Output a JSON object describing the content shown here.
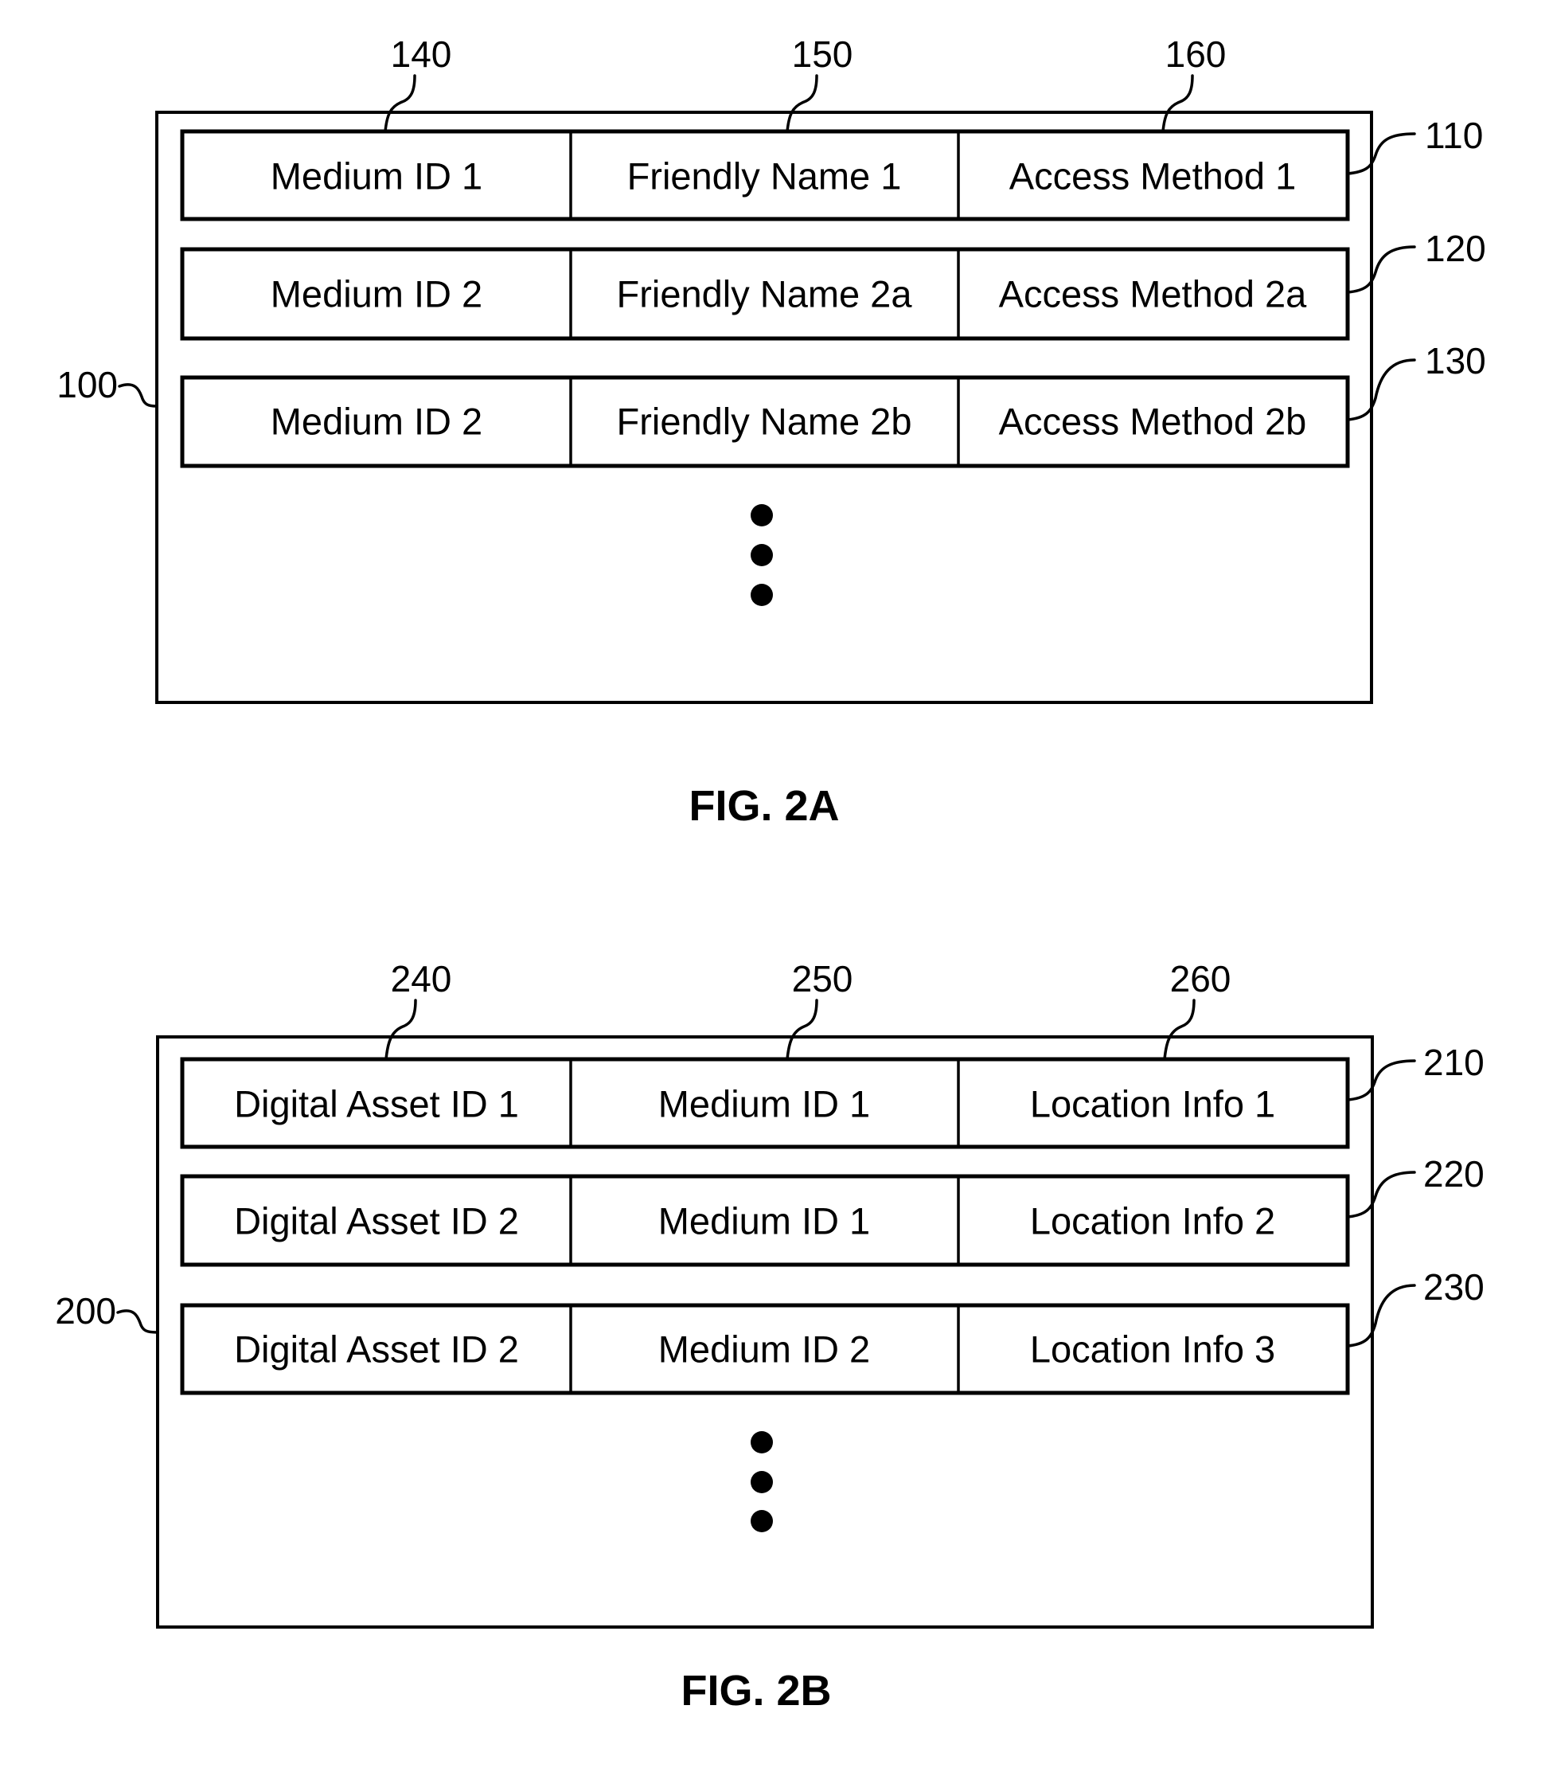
{
  "figures": [
    {
      "caption": "FIG. 2A",
      "table_ref": "100",
      "column_refs": [
        "140",
        "150",
        "160"
      ],
      "rows": [
        {
          "ref": "110",
          "cells": [
            "Medium ID 1",
            "Friendly Name 1",
            "Access Method 1"
          ]
        },
        {
          "ref": "120",
          "cells": [
            "Medium ID 2",
            "Friendly Name 2a",
            "Access Method 2a"
          ]
        },
        {
          "ref": "130",
          "cells": [
            "Medium ID 2",
            "Friendly Name 2b",
            "Access Method 2b"
          ]
        }
      ],
      "continuation": "ellipsis-vertical"
    },
    {
      "caption": "FIG. 2B",
      "table_ref": "200",
      "column_refs": [
        "240",
        "250",
        "260"
      ],
      "rows": [
        {
          "ref": "210",
          "cells": [
            "Digital Asset ID 1",
            "Medium ID 1",
            "Location Info 1"
          ]
        },
        {
          "ref": "220",
          "cells": [
            "Digital Asset ID 2",
            "Medium ID 1",
            "Location Info 2"
          ]
        },
        {
          "ref": "230",
          "cells": [
            "Digital Asset ID 2",
            "Medium ID 2",
            "Location Info 3"
          ]
        }
      ],
      "continuation": "ellipsis-vertical"
    }
  ]
}
